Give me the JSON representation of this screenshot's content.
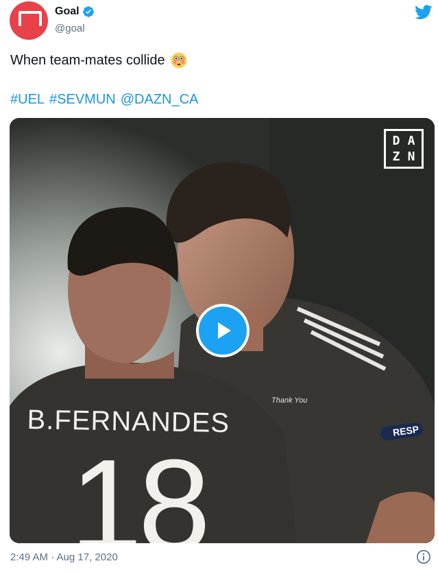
{
  "author": {
    "display_name": "Goal",
    "handle": "@goal",
    "verified": true,
    "avatar_icon": "goal-logo-icon",
    "avatar_color": "#e8414a"
  },
  "tweet": {
    "text": "When team-mates collide",
    "emoji": "flushed-face",
    "tags": [
      "#UEL",
      "#SEVMUN",
      "@DAZN_CA"
    ],
    "timestamp": "2:49 AM · Aug 17, 2020"
  },
  "media": {
    "type": "video",
    "watermark": [
      "D",
      "A",
      "Z",
      "N"
    ],
    "jersey_name": "B.FERNANDES",
    "jersey_number": "18",
    "sponsor_text": "Thank You",
    "sleeve_badge": "RESP",
    "play_icon": "play-icon"
  },
  "colors": {
    "link": "#1b95e0",
    "play_button": "#1da1f2",
    "secondary_text": "#5b7083",
    "twitter_blue": "#1da1f2"
  }
}
